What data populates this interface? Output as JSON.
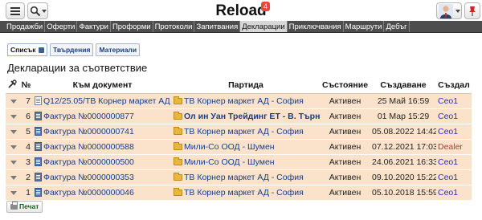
{
  "app": {
    "title": "Reload",
    "notification_count": "4"
  },
  "nav": [
    {
      "label": "Продажби",
      "active": false
    },
    {
      "label": "Оферти",
      "active": false
    },
    {
      "label": "Фактури",
      "active": false
    },
    {
      "label": "Проформи",
      "active": false
    },
    {
      "label": "Протоколи",
      "active": false
    },
    {
      "label": "Запитвания",
      "active": false
    },
    {
      "label": "Декларации",
      "active": true
    },
    {
      "label": "Приключвания",
      "active": false
    },
    {
      "label": "Маршрути",
      "active": false
    },
    {
      "label": "Дебъг",
      "active": false
    }
  ],
  "tabs": [
    {
      "label": "Списък",
      "active": true
    },
    {
      "label": "Твърдения",
      "active": false
    },
    {
      "label": "Материали",
      "active": false
    }
  ],
  "page": {
    "heading": "Декларации за съответствие"
  },
  "table": {
    "headers": [
      "",
      "№",
      "Към документ",
      "Партида",
      "Състояние",
      "Създаване",
      "Създал"
    ],
    "rows": [
      {
        "num": "7",
        "doc_type": "note",
        "doc": "Q12/25.05/ТВ Корнер маркет АД",
        "party": "ТВ Корнер маркет АД - София",
        "party_bold": false,
        "state": "Активен",
        "created": "25 Май 16:59",
        "author": "Ceo1",
        "author_color": "#2d2dcc"
      },
      {
        "num": "6",
        "doc_type": "inv",
        "doc": "Фактура №0000000877",
        "party": "Ол ин Уан Трейдинг ЕТ - В. Търново",
        "party_bold": true,
        "state": "Активен",
        "created": "01 Мар 15:29",
        "author": "Ceo1",
        "author_color": "#2d2dcc"
      },
      {
        "num": "5",
        "doc_type": "inv",
        "doc": "Фактура №0000000741",
        "party": "ТВ Корнер маркет АД - София",
        "party_bold": false,
        "state": "Активен",
        "created": "05.08.2022 14:42",
        "author": "Ceo1",
        "author_color": "#2d2dcc"
      },
      {
        "num": "4",
        "doc_type": "inv",
        "doc": "Фактура №0000000588",
        "party": "Мили-Со ООД - Шумен",
        "party_bold": false,
        "state": "Активен",
        "created": "07.12.2021 17:03",
        "author": "Dealer",
        "author_color": "#b03a3a"
      },
      {
        "num": "3",
        "doc_type": "inv",
        "doc": "Фактура №0000000500",
        "party": "Мили-Со ООД - Шумен",
        "party_bold": false,
        "state": "Активен",
        "created": "24.06.2021 16:33",
        "author": "Ceo1",
        "author_color": "#2d2dcc"
      },
      {
        "num": "2",
        "doc_type": "inv",
        "doc": "Фактура №0000000353",
        "party": "ТВ Корнер маркет АД - София",
        "party_bold": false,
        "state": "Активен",
        "created": "09.10.2020 15:22",
        "author": "Ceo1",
        "author_color": "#2d2dcc"
      },
      {
        "num": "1",
        "doc_type": "inv",
        "doc": "Фактура №0000000046",
        "party": "ТВ Корнер маркет АД - София",
        "party_bold": false,
        "state": "Активен",
        "created": "05.10.2018 15:59",
        "author": "Ceo1",
        "author_color": "#2d2dcc"
      }
    ]
  },
  "actions": {
    "print_label": "Печат"
  },
  "icons": {
    "menu": "hamburger-icon",
    "search": "search-icon",
    "avatar": "avatar-icon",
    "pin": "pin-icon",
    "tools": "tools-icon",
    "sort": "sort-arrow-icon",
    "document": "document-icon",
    "folder": "folder-icon",
    "printer": "printer-icon"
  },
  "colors": {
    "nav_bg": "#4d4d4d",
    "nav_active_bg": "#d7d7d7",
    "row_bg": "#fbe3cb",
    "link": "#173d8a",
    "badge": "#e8483c",
    "print_text": "#1b5e20"
  }
}
